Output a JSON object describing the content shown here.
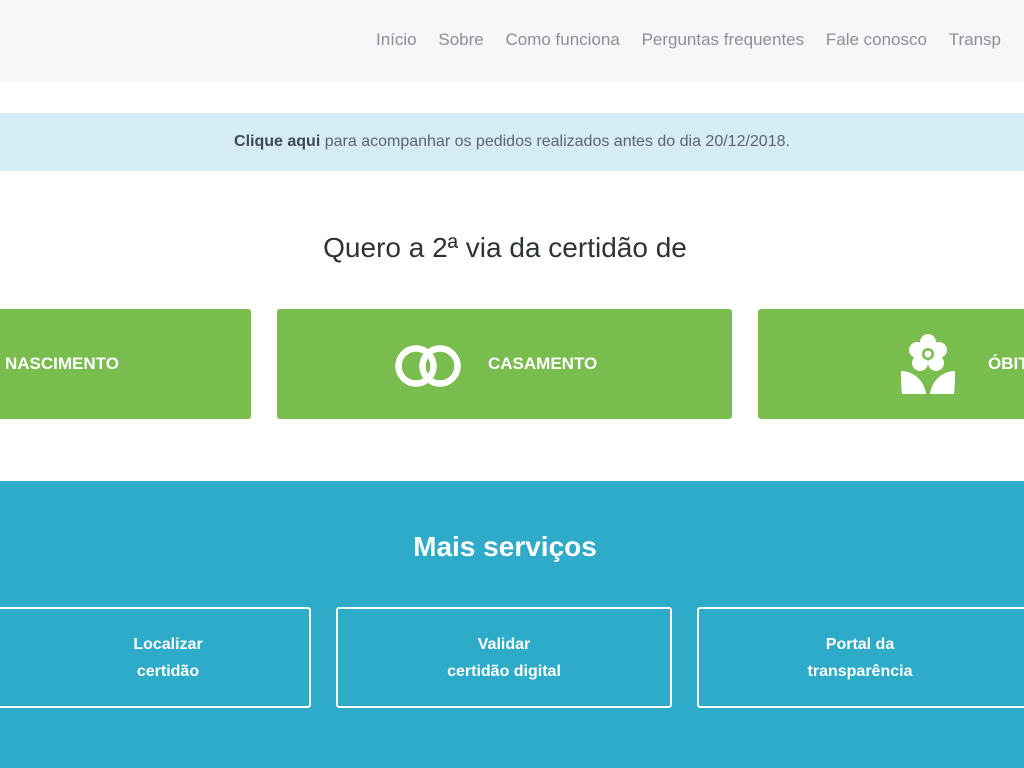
{
  "nav": {
    "items": [
      "Início",
      "Sobre",
      "Como funciona",
      "Perguntas frequentes",
      "Fale conosco",
      "Transp"
    ]
  },
  "notice": {
    "link": "Clique aqui",
    "text": " para acompanhar os pedidos realizados antes do dia 20/12/2018."
  },
  "certificates": {
    "heading": "Quero a 2ª via da certidão de",
    "items": [
      {
        "label": "NASCIMENTO",
        "icon": "baby-icon"
      },
      {
        "label": "CASAMENTO",
        "icon": "rings-icon"
      },
      {
        "label": "ÓBITO",
        "icon": "flower-icon"
      }
    ]
  },
  "services": {
    "title": "Mais serviços",
    "items": [
      {
        "line1": "Localizar",
        "line2": "certidão"
      },
      {
        "line1": "Validar",
        "line2": "certidão digital"
      },
      {
        "line1": "Portal da",
        "line2": "transparência"
      }
    ]
  },
  "colors": {
    "green": "#79bd4e",
    "blue": "#2eabc8",
    "notice_bg": "#d6ecf5"
  }
}
